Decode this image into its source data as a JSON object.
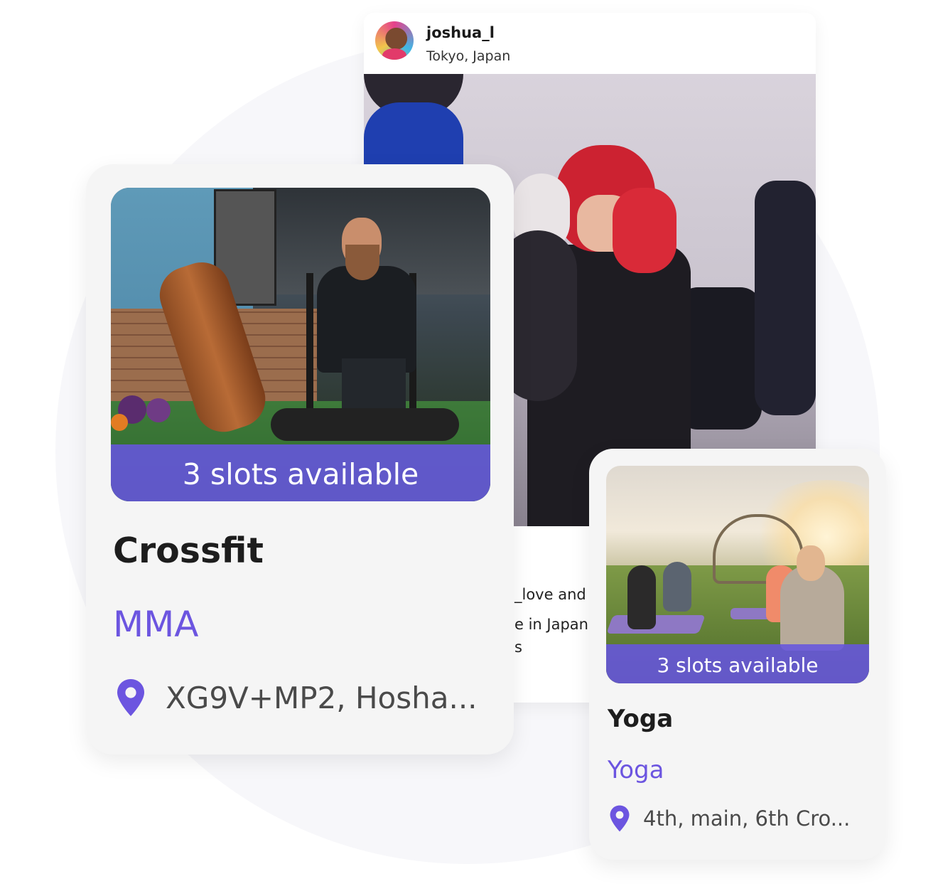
{
  "post": {
    "username": "joshua_l",
    "location": "Tokyo, Japan",
    "caption_lines": [
      "_love and",
      "e in Japan",
      "s"
    ]
  },
  "cards": [
    {
      "slots": "3 slots available",
      "title": "Crossfit",
      "category": "MMA",
      "address": "XG9V+MP2, Hosha..."
    },
    {
      "slots": "3 slots available",
      "title": "Yoga",
      "category": "Yoga",
      "address": "4th, main, 6th Cro..."
    }
  ],
  "colors": {
    "accent": "#6c55e0",
    "banner": "#6755de",
    "card_bg": "#f5f5f5",
    "circle_bg": "#f7f7fa"
  },
  "icons": [
    "location-pin-icon"
  ]
}
